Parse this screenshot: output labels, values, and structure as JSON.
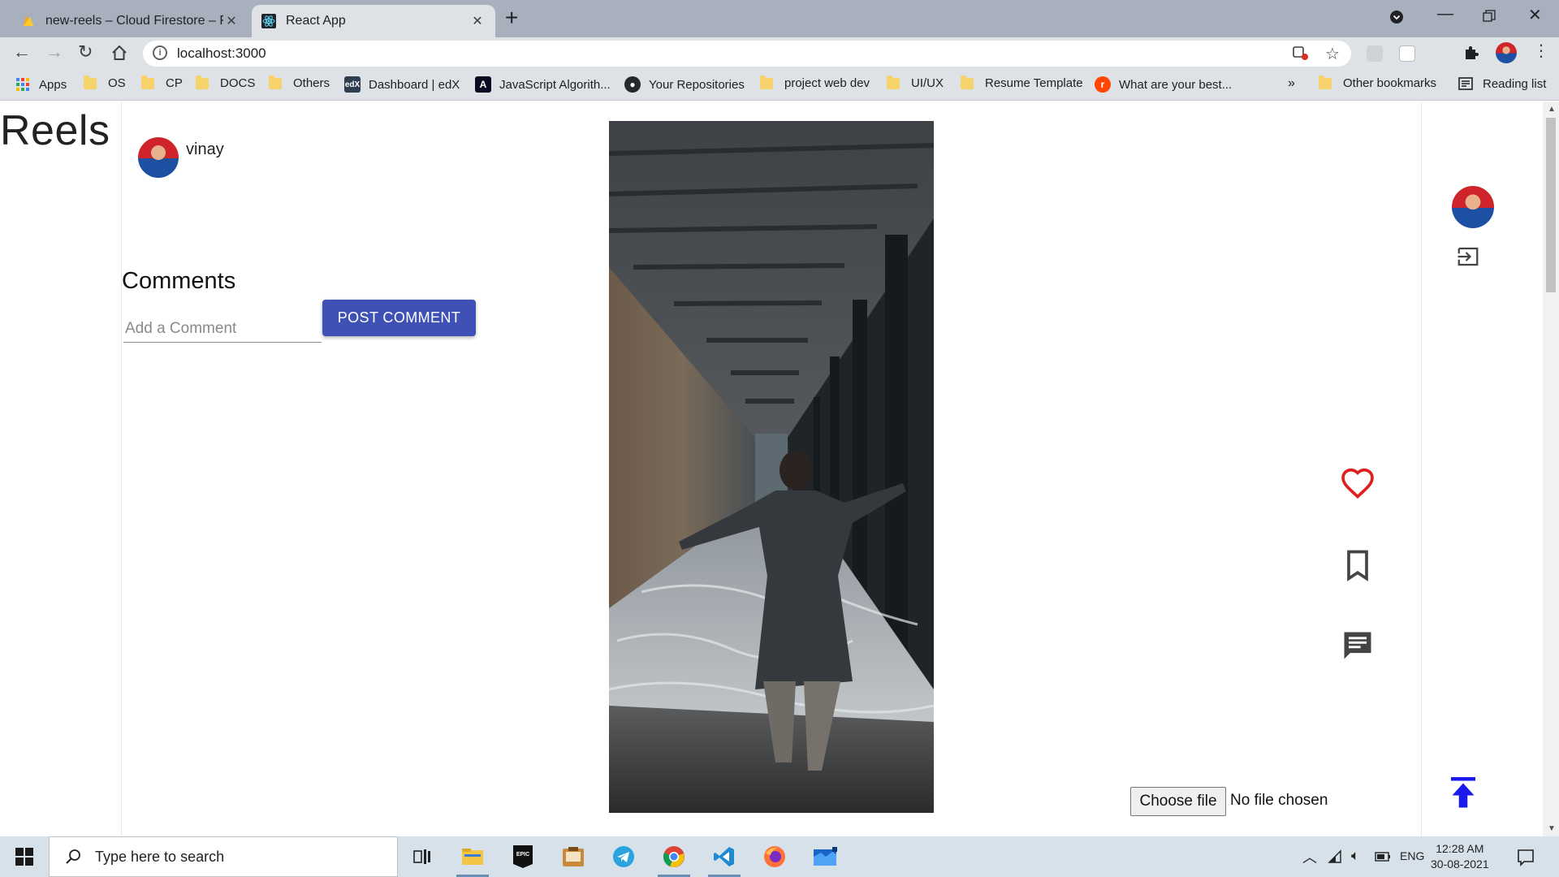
{
  "browser": {
    "tabs": [
      {
        "title": "new-reels – Cloud Firestore – Firebase console",
        "active": false,
        "icon": "firebase-icon"
      },
      {
        "title": "React App",
        "active": true,
        "icon": "react-icon"
      }
    ],
    "url": "localhost:3000",
    "bookmarks": [
      {
        "label": "Apps",
        "icon": "apps-grid-icon"
      },
      {
        "label": "OS",
        "icon": "folder-icon"
      },
      {
        "label": "CP",
        "icon": "folder-icon"
      },
      {
        "label": "DOCS",
        "icon": "folder-icon"
      },
      {
        "label": "Others",
        "icon": "folder-icon"
      },
      {
        "label": "Dashboard | edX",
        "icon": "edx-icon"
      },
      {
        "label": "JavaScript Algorith...",
        "icon": "fcc-icon"
      },
      {
        "label": "Your Repositories",
        "icon": "github-icon"
      },
      {
        "label": "project web dev",
        "icon": "folder-icon"
      },
      {
        "label": "UI/UX",
        "icon": "folder-icon"
      },
      {
        "label": "Resume Template",
        "icon": "folder-icon"
      },
      {
        "label": "What are your best...",
        "icon": "reddit-icon"
      }
    ],
    "overflow_label": "»",
    "other_bookmarks": "Other bookmarks",
    "reading_list": "Reading list"
  },
  "app": {
    "brand": "Reels",
    "post": {
      "username": "vinay"
    },
    "comments": {
      "heading": "Comments",
      "input_placeholder": "Add a Comment",
      "input_value": "",
      "post_button": "POST COMMENT"
    },
    "actions": {
      "like_color": "#e02020",
      "like_icon": "heart-outline-icon",
      "bookmark_icon": "bookmark-outline-icon",
      "comment_icon": "chat-bubble-icon"
    },
    "upload": {
      "button": "Choose file",
      "status": "No file chosen"
    },
    "navbar": {
      "logout_icon": "logout-icon",
      "scroll_top_icon": "vertical-align-top-icon",
      "scroll_top_color": "#1a1aee"
    },
    "accent_color": "#3f51b5"
  },
  "taskbar": {
    "search_placeholder": "Type here to search",
    "apps": [
      "task-view-icon",
      "file-explorer-icon",
      "epic-games-icon",
      "app-icon",
      "telegram-icon",
      "chrome-icon",
      "vscode-icon",
      "firefox-icon",
      "mail-icon"
    ],
    "language": "ENG",
    "time": "12:28 AM",
    "date": "30-08-2021"
  }
}
